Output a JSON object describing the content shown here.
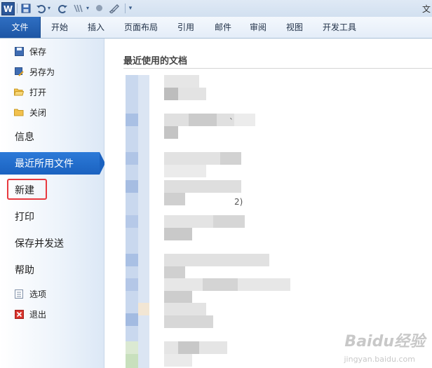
{
  "app": {
    "logo_letter": "W",
    "title_stub": "文"
  },
  "quick_access": [
    "save-icon",
    "undo-icon",
    "redo-icon",
    "format-painter-icon",
    "circle-icon",
    "pen-icon",
    "customize-dropdown-icon"
  ],
  "ribbon_tabs": [
    "文件",
    "开始",
    "插入",
    "页面布局",
    "引用",
    "邮件",
    "审阅",
    "视图",
    "开发工具"
  ],
  "backstage_small_top": [
    {
      "label": "保存",
      "icon": "save-icon"
    },
    {
      "label": "另存为",
      "icon": "save-as-icon"
    },
    {
      "label": "打开",
      "icon": "folder-open-icon"
    },
    {
      "label": "关闭",
      "icon": "folder-close-icon"
    }
  ],
  "backstage_big": [
    {
      "label": "信息"
    },
    {
      "label": "最近所用文件",
      "selected": true
    },
    {
      "label": "新建",
      "highlighted": true
    },
    {
      "label": "打印"
    },
    {
      "label": "保存并发送"
    },
    {
      "label": "帮助"
    }
  ],
  "backstage_small_bottom": [
    {
      "label": "选项",
      "icon": "options-icon"
    },
    {
      "label": "退出",
      "icon": "exit-icon"
    }
  ],
  "colors": {
    "accent": "#1b62c0",
    "highlight_box": "#e8393f"
  },
  "content": {
    "section_title": "最近使用的文档",
    "stray_text": [
      "2)",
      "`"
    ]
  },
  "watermark": {
    "main": "Baidu经验",
    "sub": "jingyan.baidu.com"
  }
}
